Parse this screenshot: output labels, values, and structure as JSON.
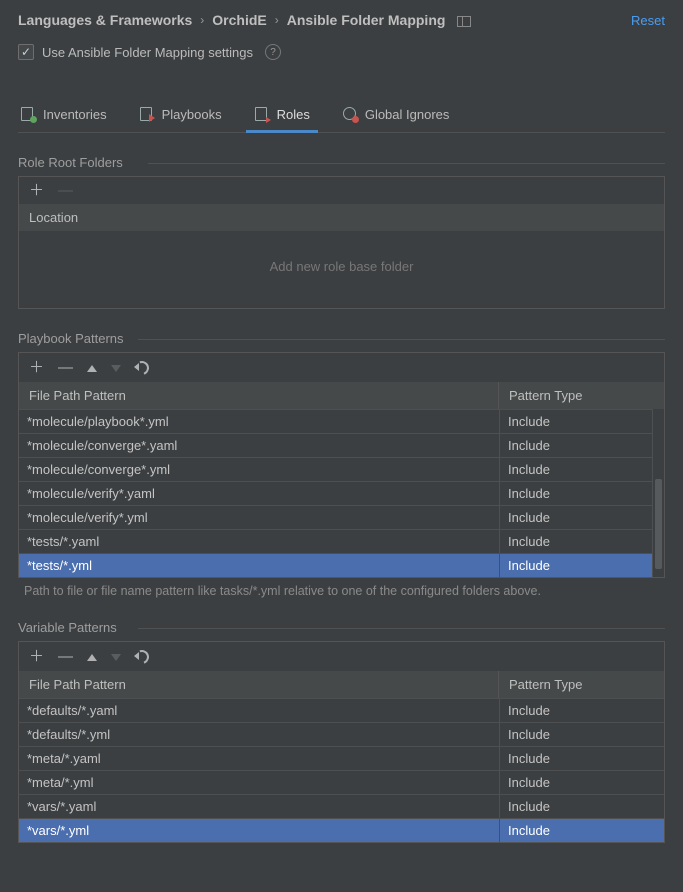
{
  "breadcrumb": {
    "seg1": "Languages & Frameworks",
    "seg2": "OrchidE",
    "seg3": "Ansible Folder Mapping"
  },
  "reset_label": "Reset",
  "use_mapping": {
    "label": "Use Ansible Folder Mapping settings",
    "checked": true
  },
  "tabs": {
    "inventories": "Inventories",
    "playbooks": "Playbooks",
    "roles": "Roles",
    "global": "Global Ignores",
    "active": "roles"
  },
  "role_root": {
    "title": "Role Root Folders",
    "header": "Location",
    "placeholder": "Add new role base folder"
  },
  "playbook_patterns": {
    "title": "Playbook Patterns",
    "col_path": "File Path Pattern",
    "col_type": "Pattern Type",
    "rows": [
      {
        "path": "*molecule/playbook*.yml",
        "type": "Include",
        "sel": false
      },
      {
        "path": "*molecule/converge*.yaml",
        "type": "Include",
        "sel": false
      },
      {
        "path": "*molecule/converge*.yml",
        "type": "Include",
        "sel": false
      },
      {
        "path": "*molecule/verify*.yaml",
        "type": "Include",
        "sel": false
      },
      {
        "path": "*molecule/verify*.yml",
        "type": "Include",
        "sel": false
      },
      {
        "path": "*tests/*.yaml",
        "type": "Include",
        "sel": false
      },
      {
        "path": "*tests/*.yml",
        "type": "Include",
        "sel": true
      }
    ],
    "hint": "Path to file or file name pattern like tasks/*.yml relative to one of the configured folders above."
  },
  "variable_patterns": {
    "title": "Variable Patterns",
    "col_path": "File Path Pattern",
    "col_type": "Pattern Type",
    "rows": [
      {
        "path": "*defaults/*.yaml",
        "type": "Include",
        "sel": false
      },
      {
        "path": "*defaults/*.yml",
        "type": "Include",
        "sel": false
      },
      {
        "path": "*meta/*.yaml",
        "type": "Include",
        "sel": false
      },
      {
        "path": "*meta/*.yml",
        "type": "Include",
        "sel": false
      },
      {
        "path": "*vars/*.yaml",
        "type": "Include",
        "sel": false
      },
      {
        "path": "*vars/*.yml",
        "type": "Include",
        "sel": true
      }
    ]
  }
}
